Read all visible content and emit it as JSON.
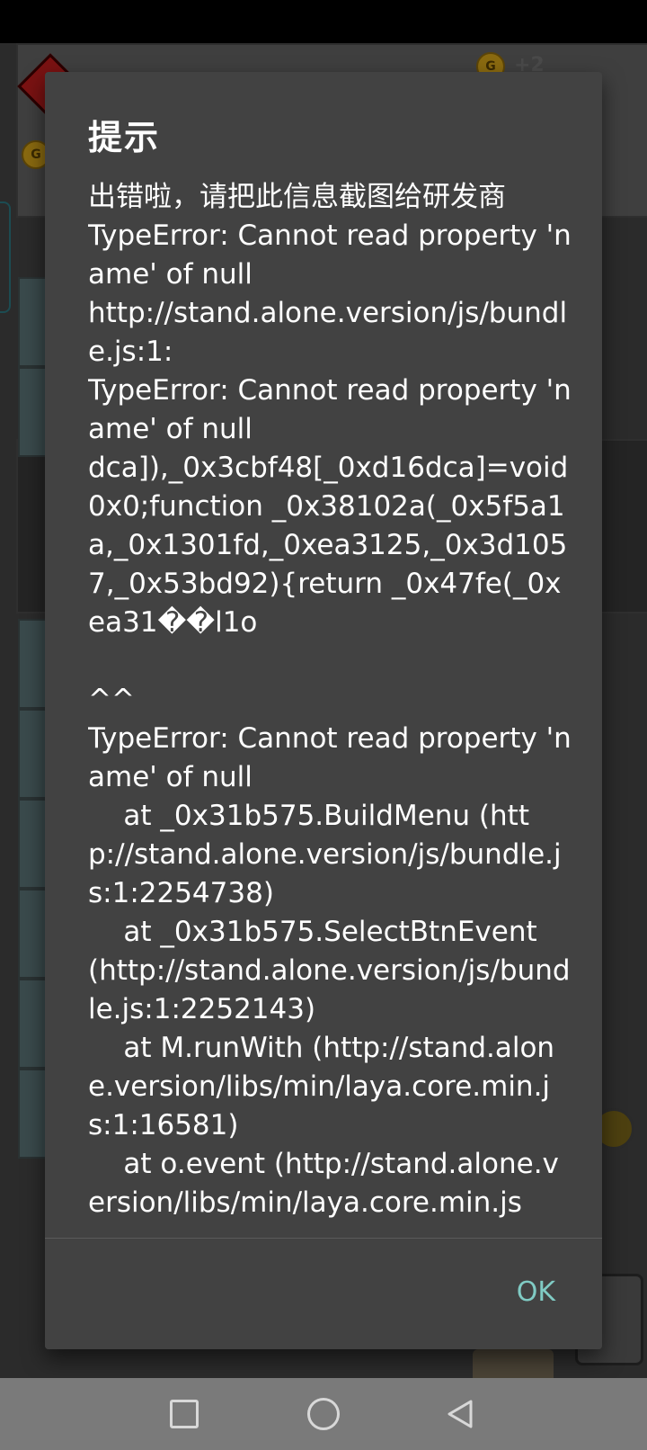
{
  "dialog": {
    "title": "提示",
    "message": "出错啦，请把此信息截图给研发商\nTypeError: Cannot read property 'name' of null\nhttp://stand.alone.version/js/bundle.js:1:\nTypeError: Cannot read property 'name' of null\ndca]),_0x3cbf48[_0xd16dca]=void 0x0;function _0x38102a(_0x5f5a1a,_0x1301fd,_0xea3125,_0x3d1057,_0x53bd92){return _0x47fe(_0xea31��l1o\n                                                       ^^\nTypeError: Cannot read property 'name' of null\n    at _0x31b575.BuildMenu (http://stand.alone.version/js/bundle.js:1:2254738)\n    at _0x31b575.SelectBtnEvent (http://stand.alone.version/js/bundle.js:1:2252143)\n    at M.runWith (http://stand.alone.version/libs/min/laya.core.min.js:1:16581)\n    at o.event (http://stand.alone.version/libs/min/laya.core.min.js",
    "ok_label": "OK"
  },
  "background_game": {
    "coin_label": "G",
    "plus_label": "+2"
  },
  "nav_bar": {
    "icons": [
      "recents-square-icon",
      "home-circle-icon",
      "back-triangle-icon"
    ]
  },
  "colors": {
    "dialog_bg": "#424242",
    "accent": "#80cbc4",
    "nav_bg": "#7a7a7a"
  }
}
